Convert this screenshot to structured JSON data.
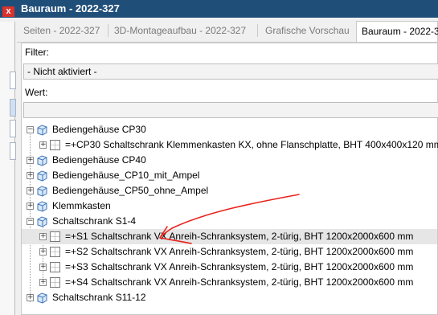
{
  "left_window": {
    "close_label": "x"
  },
  "panel": {
    "title": "Bauraum - 2022-327",
    "tabs": [
      {
        "label": "Seiten - 2022-327",
        "active": false
      },
      {
        "label": "3D-Montageaufbau - 2022-327",
        "active": false
      },
      {
        "label": "Grafische Vorschau",
        "active": false
      },
      {
        "label": "Bauraum - 2022-3",
        "active": true
      }
    ]
  },
  "filter": {
    "label": "Filter:",
    "value": "- Nicht aktiviert -"
  },
  "wert": {
    "label": "Wert:",
    "value": ""
  },
  "tree": {
    "items": [
      {
        "label": "Bediengehäuse CP30",
        "level": 0,
        "expander": "−",
        "icon": "cube-icon"
      },
      {
        "label": "=+CP30 Schaltschrank Klemmenkasten KX, ohne Flanschplatte, BHT 400x400x120 mm",
        "level": 1,
        "expander": "+",
        "icon": "cabinet-icon"
      },
      {
        "label": "Bediengehäuse CP40",
        "level": 0,
        "expander": "+",
        "icon": "cube-icon"
      },
      {
        "label": "Bediengehäuse_CP10_mit_Ampel",
        "level": 0,
        "expander": "+",
        "icon": "cube-icon"
      },
      {
        "label": "Bediengehäuse_CP50_ohne_Ampel",
        "level": 0,
        "expander": "+",
        "icon": "cube-icon"
      },
      {
        "label": "Klemmkasten",
        "level": 0,
        "expander": "+",
        "icon": "cube-icon"
      },
      {
        "label": "Schaltschrank S1-4",
        "level": 0,
        "expander": "−",
        "icon": "cube-icon"
      },
      {
        "label": "=+S1 Schaltschrank VX Anreih-Schranksystem, 2-türig, BHT 1200x2000x600 mm",
        "level": 1,
        "expander": "+",
        "icon": "cabinet-icon",
        "selected": true
      },
      {
        "label": "=+S2 Schaltschrank VX Anreih-Schranksystem, 2-türig, BHT 1200x2000x600 mm",
        "level": 1,
        "expander": "+",
        "icon": "cabinet-icon"
      },
      {
        "label": "=+S3 Schaltschrank VX Anreih-Schranksystem, 2-türig, BHT 1200x2000x600 mm",
        "level": 1,
        "expander": "+",
        "icon": "cabinet-icon"
      },
      {
        "label": "=+S4 Schaltschrank VX Anreih-Schranksystem, 2-türig, BHT 1200x2000x600 mm",
        "level": 1,
        "expander": "+",
        "icon": "cabinet-icon"
      },
      {
        "label": "Schaltschrank S11-12",
        "level": 0,
        "expander": "+",
        "icon": "cube-icon"
      }
    ]
  },
  "colors": {
    "title_bar": "#1f4e79",
    "annotation": "#e8231d",
    "close_button": "#d9322c"
  }
}
